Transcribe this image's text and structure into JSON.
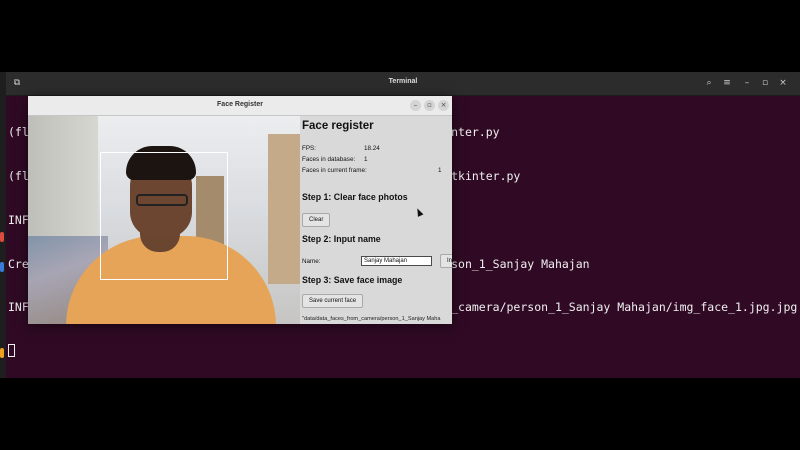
{
  "terminal": {
    "title": "Terminal",
    "lines": [
      "(fl                                                           kinter.py",
      "(fl                                                           a_tkinter.py",
      "INF",
      "Cre                                                           erson_1_Sanjay Mahajan",
      "INF                                                           om_camera/person_1_Sanjay Mahajan/img_face_1.jpg.jpg"
    ],
    "icons": [
      "terminal-icon",
      "search-icon",
      "menu-icon",
      "minimize-icon",
      "maximize-icon",
      "close-icon"
    ]
  },
  "face_register": {
    "window_title": "Face Register",
    "panel": {
      "title": "Face register",
      "fps_label": "FPS:",
      "fps_value": "18.24",
      "faces_db_label": "Faces in database:",
      "faces_db_value": "1",
      "faces_frame_label": "Faces in current frame:",
      "faces_frame_value": "1",
      "step1": "Step 1: Clear face photos",
      "clear_button": "Clear",
      "step2": "Step 2: Input name",
      "name_label": "Name:",
      "name_value": "Sanjay Mahajan",
      "input_button": "In",
      "step3": "Step 3: Save face image",
      "save_button": "Save current face",
      "saved_path": "\"data/data_faces_from_camera/person_1_Sanjay Maha"
    }
  },
  "colors": {
    "terminal_bg": "#300a24",
    "window_bg": "#d9d9d9",
    "face_box": "#ffffff"
  }
}
